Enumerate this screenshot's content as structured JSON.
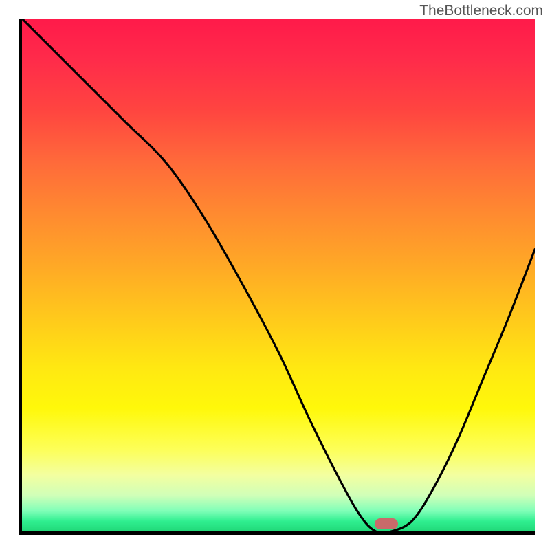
{
  "watermark": "TheBottleneck.com",
  "chart_data": {
    "type": "line",
    "title": "",
    "xlabel": "",
    "ylabel": "",
    "xlim": [
      0,
      100
    ],
    "ylim": [
      0,
      100
    ],
    "x": [
      0,
      10,
      20,
      28,
      35,
      42,
      50,
      56,
      62,
      66,
      69,
      72,
      76,
      80,
      85,
      90,
      95,
      100
    ],
    "y": [
      100,
      90,
      80,
      72,
      62,
      50,
      35,
      22,
      10,
      3,
      0,
      0,
      2,
      8,
      18,
      30,
      42,
      55
    ],
    "gradient_stops": [
      {
        "pos": 0,
        "color": "#ff1a4a"
      },
      {
        "pos": 50,
        "color": "#ffc81c"
      },
      {
        "pos": 80,
        "color": "#fff80a"
      },
      {
        "pos": 95,
        "color": "#80ffb8"
      },
      {
        "pos": 100,
        "color": "#20d878"
      }
    ],
    "marker": {
      "x": 71,
      "y": 1.5,
      "color": "#c96a6a"
    }
  }
}
